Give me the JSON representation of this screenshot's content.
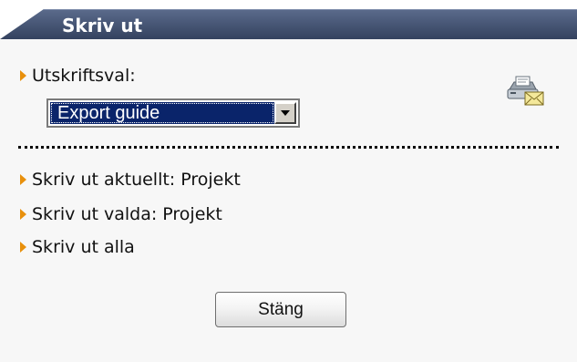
{
  "panel": {
    "title": "Skriv ut"
  },
  "print_options": {
    "label": "Utskriftsval:",
    "selected_value": "Export guide",
    "icon": "printer-mail-icon"
  },
  "actions": [
    {
      "label": "Skriv ut aktuellt: Projekt"
    },
    {
      "label": "Skriv ut valda: Projekt"
    },
    {
      "label": "Skriv ut alla"
    }
  ],
  "close_button": {
    "label": "Stäng"
  },
  "colors": {
    "header": "#3f4f6e",
    "arrow": "#e8900c",
    "selection": "#0a246a",
    "body_background": "#f7f7f7"
  }
}
